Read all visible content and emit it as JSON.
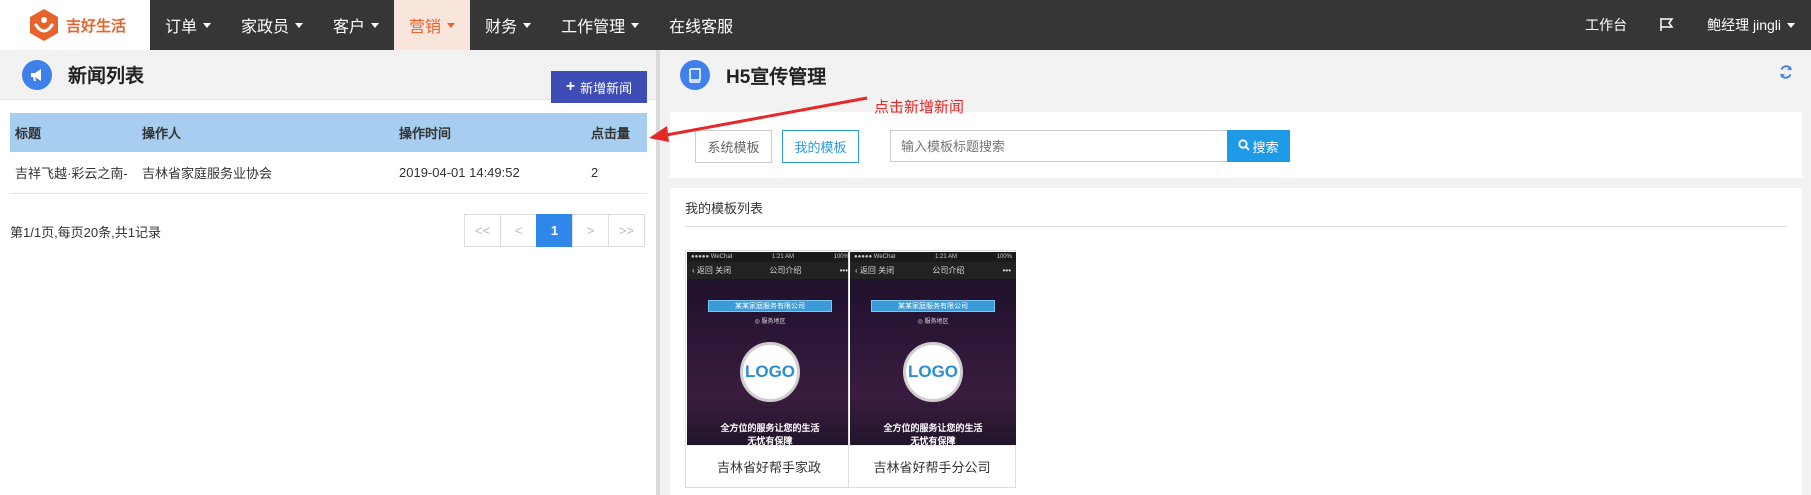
{
  "brand": {
    "name": "吉好生活",
    "color": "#e8632b"
  },
  "nav": {
    "items": [
      {
        "label": "订单",
        "dropdown": true
      },
      {
        "label": "家政员",
        "dropdown": true
      },
      {
        "label": "客户",
        "dropdown": true
      },
      {
        "label": "营销",
        "dropdown": true,
        "active": true
      },
      {
        "label": "财务",
        "dropdown": true
      },
      {
        "label": "工作管理",
        "dropdown": true
      },
      {
        "label": "在线客服",
        "dropdown": false
      }
    ],
    "workbench": "工作台",
    "user": "鲍经理 jingli"
  },
  "news_panel": {
    "title": "新闻列表",
    "add_button": "新增新闻",
    "columns": [
      "标题",
      "操作人",
      "操作时间",
      "点击量"
    ],
    "rows": [
      {
        "title": "吉祥飞越·彩云之南-",
        "operator": "吉林省家庭服务业协会",
        "time": "2019-04-01 14:49:52",
        "clicks": "2"
      }
    ],
    "page_info": "第1/1页,每页20条,共1记录",
    "pager": {
      "first": "<<",
      "prev": "<",
      "current": "1",
      "next": ">",
      "last": ">>"
    }
  },
  "annotation": {
    "text": "点击新增新闻",
    "color": "#e62828"
  },
  "h5_panel": {
    "title": "H5宣传管理",
    "tabs": [
      "系统模板",
      "我的模板"
    ],
    "active_tab": "我的模板",
    "search_placeholder": "输入模板标题搜索",
    "search_button": "搜索",
    "list_title": "我的模板列表",
    "templates": [
      {
        "name": "吉林省好帮手家政",
        "preview": {
          "status_left": "●●●●● WeChat",
          "status_time": "1:21 AM",
          "status_right": "100%",
          "back": "返回  关闭",
          "page_title": "公司介绍",
          "more": "•••",
          "banner": "某某家庭服务有限公司",
          "sub": "◎ 服务地区",
          "logo": "LOGO",
          "slogan_1": "全方位的服务让您的生活",
          "slogan_2": "无忧有保障"
        }
      },
      {
        "name": "吉林省好帮手分公司",
        "preview": {
          "status_left": "●●●●● WeChat",
          "status_time": "1:21 AM",
          "status_right": "100%",
          "back": "返回  关闭",
          "page_title": "公司介绍",
          "more": "•••",
          "banner": "某某家庭服务有限公司",
          "sub": "◎ 服务地区",
          "logo": "LOGO",
          "slogan_1": "全方位的服务让您的生活",
          "slogan_2": "无忧有保障"
        }
      }
    ]
  },
  "colors": {
    "nav_bg": "#363636",
    "active_nav_bg": "#f8e6dc",
    "add_button": "#3d4db5",
    "table_header": "#a7cdf0",
    "search_button": "#1f9ae6",
    "pager_current": "#2f87e9"
  }
}
